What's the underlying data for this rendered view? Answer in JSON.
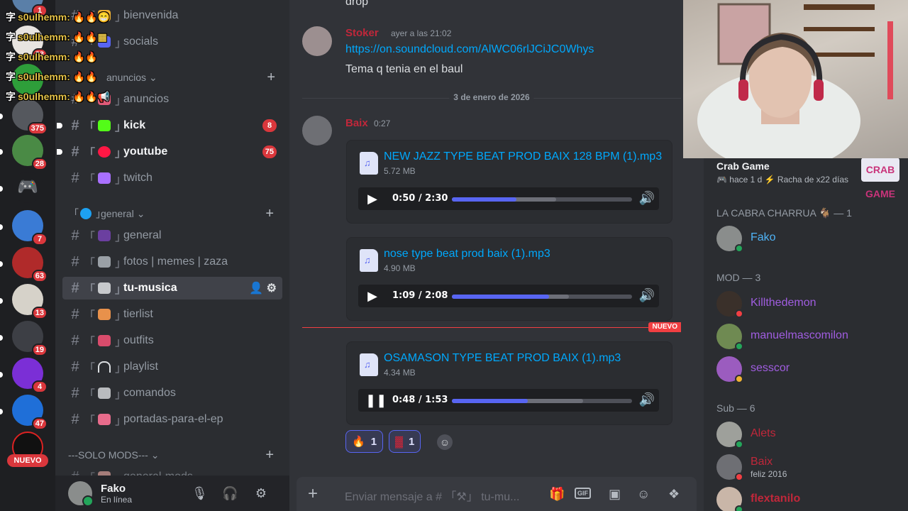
{
  "overlay": {
    "symbol": "字",
    "lines": [
      "s0ulhemm: 🔥🔥😁",
      "s0ulhemm: 🔥🔥▦",
      "s0ulhemm: 🔥🔥",
      "s0ulhemm: 🔥🔥",
      "s0ulhemm: 🔥🔥📢"
    ]
  },
  "rail": {
    "badges": [
      "1",
      "83",
      "375",
      "28",
      "7",
      "63",
      "13",
      "19",
      "4",
      "47"
    ],
    "new_label": "NUEVO"
  },
  "sidebar": {
    "categories": {
      "anuncios": "anuncios",
      "general": "general",
      "mods": "---SOLO MODS---"
    },
    "channels": {
      "bienvenida": "bienvenida",
      "socials": "socials",
      "anuncios": "anuncios",
      "kick": "kick",
      "kick_badge": "8",
      "youtube": "youtube",
      "youtube_badge": "75",
      "twitch": "twitch",
      "general": "general",
      "fotos": "fotos | memes | zaza",
      "tu_musica": "tu-musica",
      "tierlist": "tierlist",
      "outfits": "outfits",
      "playlist": "playlist",
      "comandos": "comandos",
      "portadas": "portadas-para-el-ep",
      "general_mods": "general-mods"
    },
    "user": {
      "name": "Fako",
      "status": "En línea"
    }
  },
  "chat": {
    "top_text": "drop",
    "msg1": {
      "author": "Stoker",
      "time": "ayer a las 21:02",
      "link": "https://on.soundcloud.com/AlWC06rlJCiJC0Whys",
      "text": "Tema q tenia en el baul"
    },
    "date_divider": "3 de enero de 2026",
    "msg2": {
      "author": "Baix",
      "time": "0:27"
    },
    "attachments": [
      {
        "name": "NEW JAZZ TYPE BEAT PROD BAIX 128 BPM (1).mp3",
        "size": "5.72 MB",
        "time": "0:50 / 2:30",
        "progress": 0.36,
        "buffered": 0.58
      },
      {
        "name": "nose type beat prod baix (1).mp3",
        "size": "4.90 MB",
        "time": "1:09 / 2:08",
        "progress": 0.54,
        "buffered": 0.65
      },
      {
        "name": "OSAMASON TYPE BEAT PROD BAIX (1).mp3",
        "size": "4.34 MB",
        "time": "0:48 / 1:53",
        "progress": 0.42,
        "buffered": 0.73
      }
    ],
    "new_label": "NUEVO",
    "reactions": [
      {
        "emoji": "🔥",
        "count": "1"
      },
      {
        "emoji": "▓",
        "count": "1"
      }
    ],
    "composer_placeholder": "Enviar mensaje a # 「⚒」 tu-mu..."
  },
  "members": {
    "activity": {
      "title": "Crab Game",
      "meta": "🎮 hace 1 d  ⚡ Racha de x22 días",
      "logo": "CRAB GAME"
    },
    "groups": [
      {
        "title": "LA CABRA CHARRUA 🐐 — 1",
        "members": [
          {
            "name": "Fako",
            "color": "#4fb3f6"
          }
        ]
      },
      {
        "title": "MOD — 3",
        "members": [
          {
            "name": "Killthedemon",
            "color": "#a05de0"
          },
          {
            "name": "manuelmascomilon",
            "color": "#a05de0"
          },
          {
            "name": "sesscor",
            "color": "#a05de0"
          }
        ]
      },
      {
        "title": "Sub — 6",
        "members": [
          {
            "name": "Alets",
            "color": "#c0273a"
          },
          {
            "name": "Baix",
            "color": "#c0273a",
            "sub": "feliz 2016"
          },
          {
            "name": "flextanilo",
            "color": "#c0273a"
          }
        ]
      }
    ]
  },
  "colors": {
    "accent": "#5865f2",
    "link": "#00a8fc",
    "badge_red": "#da373c",
    "online": "#23a55a"
  }
}
